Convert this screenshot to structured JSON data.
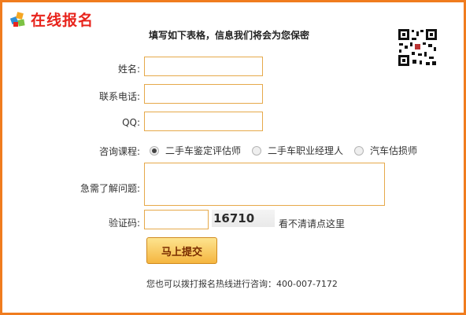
{
  "header": {
    "logo_text": "在线报名",
    "note": "填写如下表格，信息我们将会为您保密",
    "logo_colors": [
      "#e8241c",
      "#2e8fd6",
      "#7cc243",
      "#f5a623"
    ]
  },
  "form": {
    "name_label": "姓名:",
    "phone_label": "联系电话:",
    "qq_label": "QQ:",
    "course_label": "咨询课程:",
    "question_label": "急需了解问题:",
    "captcha_label": "验证码:",
    "name_value": "",
    "phone_value": "",
    "qq_value": "",
    "question_value": "",
    "captcha_value": "",
    "captcha_code": "16710",
    "refresh_text": "看不清请点这里",
    "courses": [
      {
        "label": "二手车鉴定评估师",
        "checked": true
      },
      {
        "label": "二手车职业经理人",
        "checked": false
      },
      {
        "label": "汽车估损师",
        "checked": false
      }
    ],
    "submit_label": "马上提交"
  },
  "footer": {
    "hotline_text": "您也可以拨打报名热线进行咨询：400-007-7172"
  },
  "colors": {
    "frame": "#f07c1e",
    "field_border": "#e6a94a",
    "logo_red": "#e8241c"
  }
}
